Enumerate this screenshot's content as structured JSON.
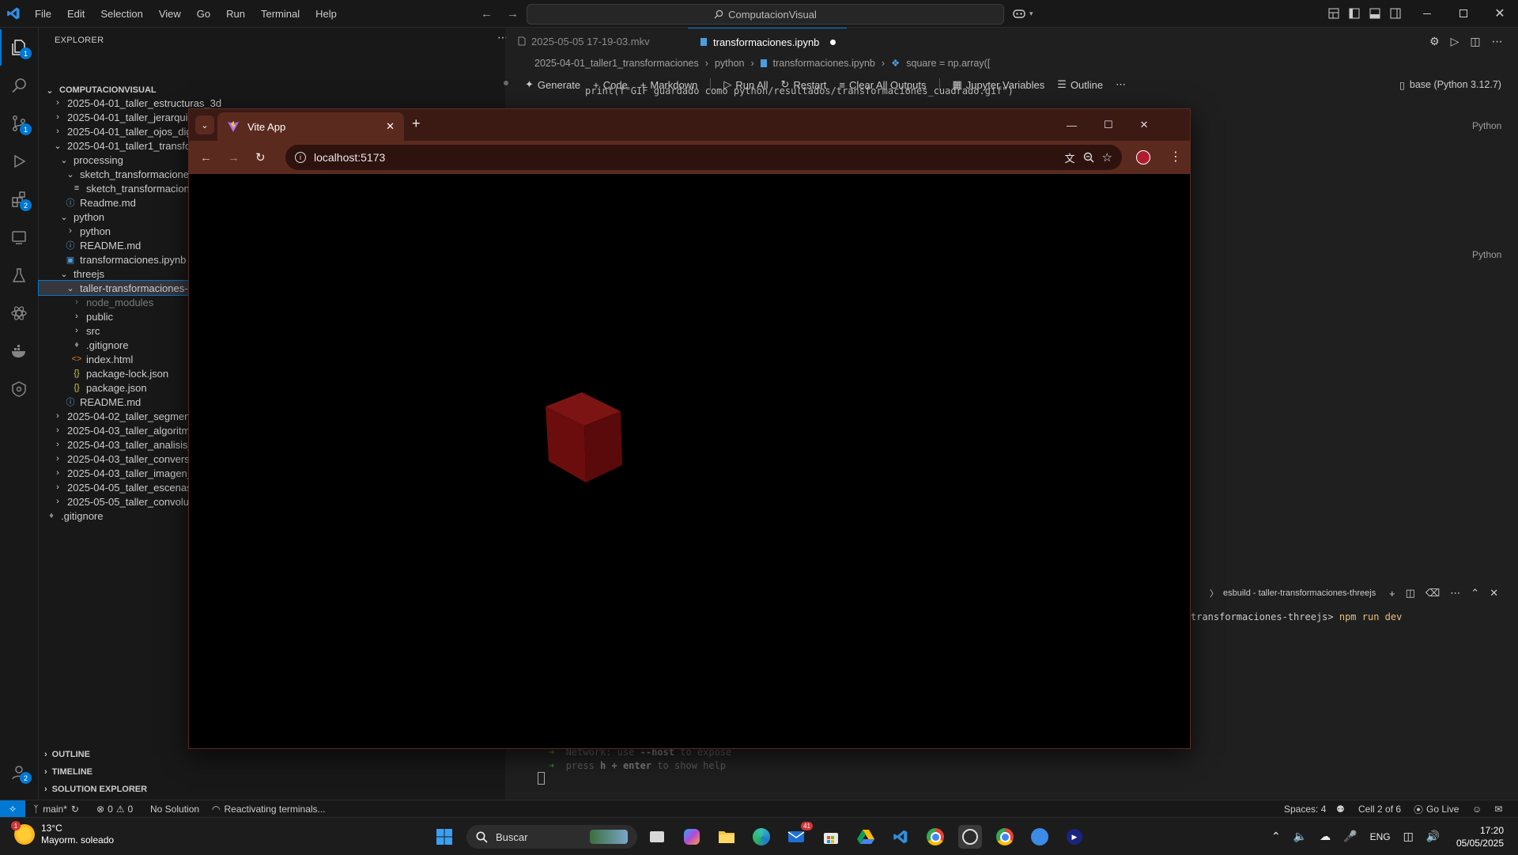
{
  "vscode": {
    "menu": [
      "File",
      "Edit",
      "Selection",
      "View",
      "Go",
      "Run",
      "Terminal",
      "Help"
    ],
    "search": "ComputacionVisual",
    "explorer": {
      "title": "EXPLORER",
      "root": "COMPUTACIONVISUAL",
      "items": [
        "2025-04-01_taller_estructuras_3d",
        "2025-04-01_taller_jerarquias_transformaciones",
        "2025-04-01_taller_ojos_digi",
        "2025-04-01_taller1_transfor",
        "processing",
        "sketch_transformaciones",
        "sketch_transformacione",
        "Readme.md",
        "python",
        "python",
        "README.md",
        "transformaciones.ipynb",
        "threejs",
        "taller-transformaciones-t",
        "node_modules",
        "public",
        "src",
        ".gitignore",
        "index.html",
        "package-lock.json",
        "package.json",
        "README.md",
        "2025-04-02_taller_segment",
        "2025-04-03_taller_algoritm",
        "2025-04-03_taller_analisis_f",
        "2025-04-03_taller_conversi",
        "2025-04-03_taller_imagen_",
        "2025-04-05_taller_escenas_",
        "2025-05-05_taller_convoluc",
        ".gitignore"
      ],
      "sections": [
        "OUTLINE",
        "TIMELINE",
        "SOLUTION EXPLORER"
      ]
    },
    "tabs": [
      "2025-05-05 17-19-03.mkv",
      "transformaciones.ipynb"
    ],
    "breadcrumbs": [
      "2025-04-01_taller1_transformaciones",
      "python",
      "transformaciones.ipynb",
      "square = np.array(["
    ],
    "toolbar": [
      "Generate",
      "Code",
      "Markdown",
      "Run All",
      "Restart",
      "Clear All Outputs",
      "Jupyter Variables",
      "Outline"
    ],
    "kernel": "base (Python 3.12.7)",
    "code_peek": "print(f\"GIF guardado como python/resultados/transformaciones_cuadrado.gif\")",
    "cell_lang": "Python",
    "terminal": {
      "tab": "esbuild - taller-transformaciones-threejs",
      "prompt": "transformaciones-threejs>",
      "command": "npm run dev",
      "lines": [
        {
          "a": "Network:",
          "b": "use",
          "c": "--host",
          "d": "to expose"
        },
        {
          "a": "press",
          "b": "h + enter",
          "c": "to show help",
          "d": ""
        }
      ]
    },
    "status": {
      "branch": "main*",
      "errors": "0",
      "warnings": "0",
      "solution": "No Solution",
      "task": "Reactivating terminals...",
      "spaces": "Spaces: 4",
      "cell": "Cell 2 of 6",
      "golive": "Go Live"
    },
    "badges": {
      "explorer": "1",
      "scm": "1",
      "ext": "2",
      "accounts": "2"
    }
  },
  "browser": {
    "tab_title": "Vite App",
    "url": "localhost:5173",
    "cube_color": "#6b0d0d"
  },
  "taskbar": {
    "weather_temp": "13°C",
    "weather_desc": "Mayorm. soleado",
    "search": "Buscar",
    "lang": "ENG",
    "time": "17:20",
    "date": "05/05/2025",
    "mail_badge": "41"
  }
}
